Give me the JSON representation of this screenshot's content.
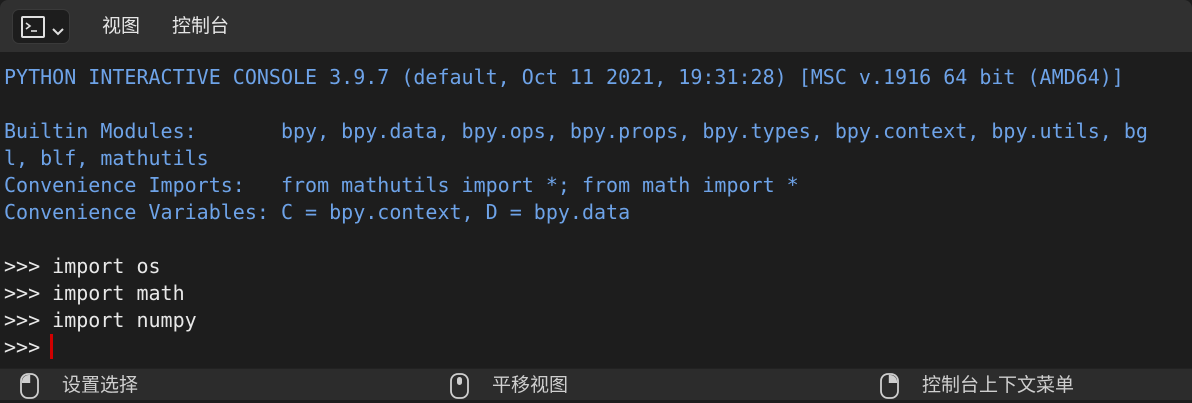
{
  "header": {
    "menu": [
      {
        "label": "视图"
      },
      {
        "label": "控制台"
      }
    ],
    "editor_icon": "console-icon"
  },
  "console": {
    "lines": [
      "PYTHON INTERACTIVE CONSOLE 3.9.7 (default, Oct 11 2021, 19:31:28) [MSC v.1916 64 bit (AMD64)]",
      "",
      "Builtin Modules:       bpy, bpy.data, bpy.ops, bpy.props, bpy.types, bpy.context, bpy.utils, bg",
      "l, blf, mathutils",
      "Convenience Imports:   from mathutils import *; from math import *",
      "Convenience Variables: C = bpy.context, D = bpy.data",
      "",
      ">>> import os",
      ">>> import math",
      ">>> import numpy",
      ">>> "
    ],
    "output_color": "#6ea3e8",
    "input_color": "#e8e8e8",
    "cursor_color": "#d00000"
  },
  "statusbar": {
    "items": [
      {
        "icon": "mouse-left-icon",
        "label": "设置选择"
      },
      {
        "icon": "mouse-middle-icon",
        "label": "平移视图"
      },
      {
        "icon": "mouse-right-icon",
        "label": "控制台上下文菜单"
      }
    ]
  }
}
